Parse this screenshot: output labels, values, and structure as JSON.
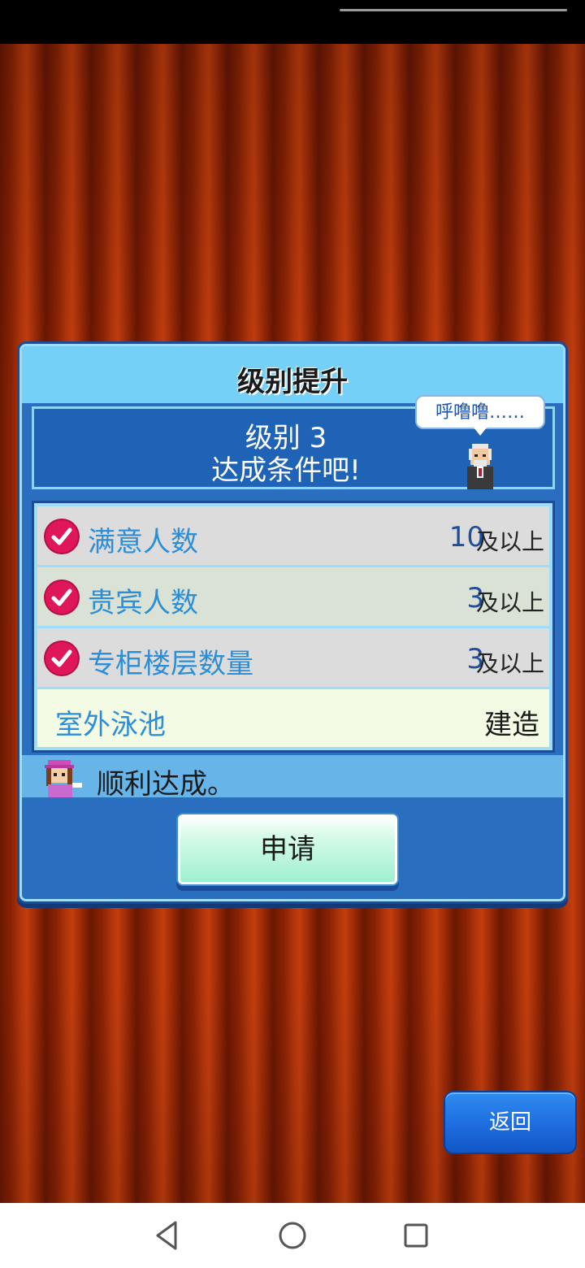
{
  "dialog": {
    "title": "级别提升",
    "level_line1": "级别 3",
    "level_line2": "达成条件吧!",
    "speech": "呼噜噜……",
    "conditions": [
      {
        "label": "满意人数",
        "value": "10",
        "suffix": "及以上",
        "met": true
      },
      {
        "label": "贵宾人数",
        "value": "3",
        "suffix": "及以上",
        "met": true
      },
      {
        "label": "专柜楼层数量",
        "value": "3",
        "suffix": "及以上",
        "met": true
      },
      {
        "label": "室外泳池",
        "status": "建造",
        "met": false
      }
    ],
    "message": "顺利达成。",
    "apply_label": "申请"
  },
  "back_label": "返回",
  "colors": {
    "curtain": "#b3360a",
    "dialog_bg": "#2a6ec0",
    "header_bg": "#74d0f6",
    "check": "#e0165a",
    "label": "#2b8ed6",
    "back_button": "#1f6fe0"
  },
  "nav": {
    "back_icon": "triangle-back-icon",
    "home_icon": "circle-home-icon",
    "recents_icon": "square-recents-icon"
  }
}
